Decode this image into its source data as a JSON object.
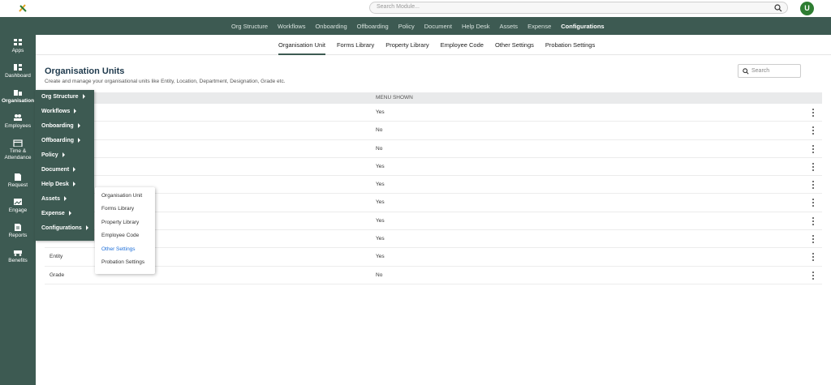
{
  "topbar": {
    "search_placeholder": "Search Module...",
    "avatar_initial": "U"
  },
  "module_nav": [
    {
      "label": "Org Structure",
      "active": false
    },
    {
      "label": "Workflows",
      "active": false
    },
    {
      "label": "Onboarding",
      "active": false
    },
    {
      "label": "Offboarding",
      "active": false
    },
    {
      "label": "Policy",
      "active": false
    },
    {
      "label": "Document",
      "active": false
    },
    {
      "label": "Help Desk",
      "active": false
    },
    {
      "label": "Assets",
      "active": false
    },
    {
      "label": "Expense",
      "active": false
    },
    {
      "label": "Configurations",
      "active": true
    }
  ],
  "sidebar": [
    {
      "label": "Apps",
      "icon": "apps-grid-icon"
    },
    {
      "label": "Dashboard",
      "icon": "dashboard-icon"
    },
    {
      "label": "Organisation",
      "icon": "organisation-icon",
      "active": true
    },
    {
      "label": "Employees",
      "icon": "employees-icon"
    },
    {
      "label": "Time & Attendance",
      "icon": "calendar-icon"
    },
    {
      "label": "Request",
      "icon": "request-icon"
    },
    {
      "label": "Engage",
      "icon": "engage-icon"
    },
    {
      "label": "Reports",
      "icon": "reports-icon"
    },
    {
      "label": "Benefits",
      "icon": "benefits-icon"
    }
  ],
  "sub_nav": [
    {
      "label": "Organisation Unit",
      "active": true
    },
    {
      "label": "Forms Library",
      "active": false
    },
    {
      "label": "Property Library",
      "active": false
    },
    {
      "label": "Employee Code",
      "active": false
    },
    {
      "label": "Other Settings",
      "active": false
    },
    {
      "label": "Probation Settings",
      "active": false
    }
  ],
  "page": {
    "title": "Organisation Units",
    "subtitle": "Create and manage your organisational units like Entity, Location, Department, Designation, Grade etc.",
    "search_placeholder": "Search"
  },
  "table": {
    "col2_header": "MENU SHOWN",
    "rows": [
      {
        "name": "",
        "menu": "Yes"
      },
      {
        "name": "",
        "menu": "No"
      },
      {
        "name": "",
        "menu": "No"
      },
      {
        "name": "",
        "menu": "Yes"
      },
      {
        "name": "",
        "menu": "Yes"
      },
      {
        "name": "",
        "menu": "Yes"
      },
      {
        "name": "",
        "menu": "Yes"
      },
      {
        "name": "",
        "menu": "Yes"
      },
      {
        "name": "Entity",
        "menu": "Yes"
      },
      {
        "name": "Grade",
        "menu": "No"
      }
    ]
  },
  "flyout_main": [
    "Org Structure",
    "Workflows",
    "Onboarding",
    "Offboarding",
    "Policy",
    "Document",
    "Help Desk",
    "Assets",
    "Expense",
    "Configurations"
  ],
  "flyout_config": [
    {
      "label": "Organisation Unit",
      "active": false
    },
    {
      "label": "Forms Library",
      "active": false
    },
    {
      "label": "Property Library",
      "active": false
    },
    {
      "label": "Employee Code",
      "active": false
    },
    {
      "label": "Other Settings",
      "active": true
    },
    {
      "label": "Probation Settings",
      "active": false
    }
  ],
  "colors": {
    "brand": "#3d5a52",
    "link_active": "#1e6fd9",
    "avatar": "#2e7d32"
  }
}
